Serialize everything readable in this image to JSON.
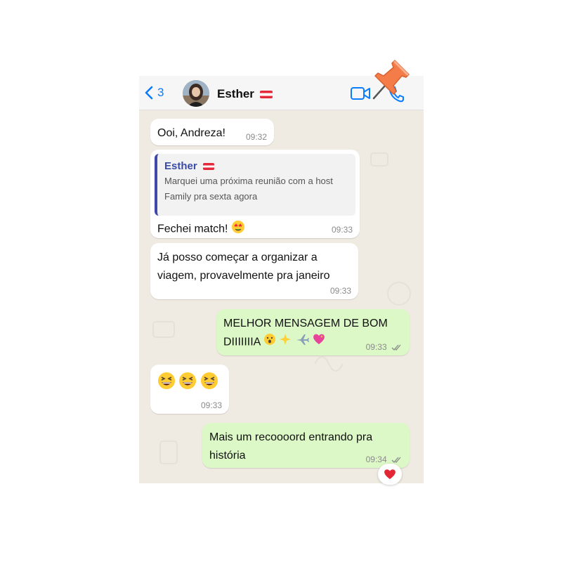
{
  "header": {
    "back_count": "3",
    "contact_name": "Esther"
  },
  "messages": [
    {
      "text": "Ooi, Andreza!",
      "time": "09:32"
    },
    {
      "quote_name": "Esther",
      "quote_text": "Marquei uma próxima reunião com a host Family pra sexta agora",
      "text": "Fechei match!",
      "time": "09:33"
    },
    {
      "text": "Já posso começar a organizar a viagem, provavelmente pra janeiro",
      "time": "09:33"
    },
    {
      "text": "MELHOR MENSAGEM DE BOM DIIIIIIIA",
      "time": "09:33"
    },
    {
      "time": "09:33"
    },
    {
      "text": "Mais um recoooord entrando pra história",
      "time": "09:34"
    }
  ],
  "colors": {
    "accent": "#0a7cff",
    "incoming_bubble": "#ffffff",
    "outgoing_bubble": "#dcf8c6",
    "wallpaper": "#efeae2",
    "quote_bar": "#3f47a8",
    "pin": "#f47c48"
  },
  "icons": [
    "chevron-left-icon",
    "video-call-icon",
    "phone-call-icon",
    "push-pin-icon",
    "double-check-icon",
    "heart-icon"
  ]
}
